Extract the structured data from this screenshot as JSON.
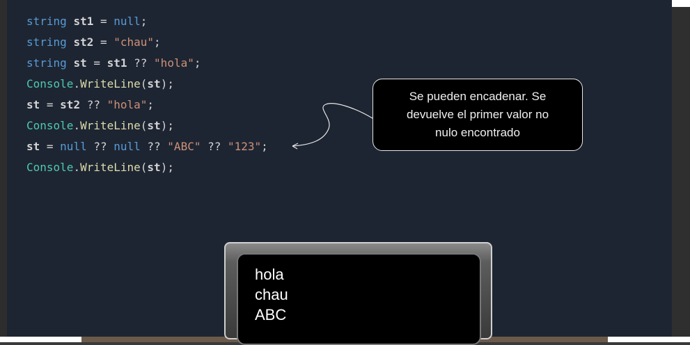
{
  "code": {
    "lines": [
      [
        {
          "t": "string ",
          "c": "kw"
        },
        {
          "t": "st1",
          "c": "var"
        },
        {
          "t": " = ",
          "c": "op"
        },
        {
          "t": "null",
          "c": "kw"
        },
        {
          "t": ";",
          "c": "op"
        }
      ],
      [
        {
          "t": "string ",
          "c": "kw"
        },
        {
          "t": "st2",
          "c": "var"
        },
        {
          "t": " = ",
          "c": "op"
        },
        {
          "t": "\"chau\"",
          "c": "str"
        },
        {
          "t": ";",
          "c": "op"
        }
      ],
      [
        {
          "t": "string ",
          "c": "kw"
        },
        {
          "t": "st",
          "c": "var"
        },
        {
          "t": " = ",
          "c": "op"
        },
        {
          "t": "st1",
          "c": "var"
        },
        {
          "t": " ?? ",
          "c": "op"
        },
        {
          "t": "\"hola\"",
          "c": "str"
        },
        {
          "t": ";",
          "c": "op"
        }
      ],
      [
        {
          "t": "Console",
          "c": "cls"
        },
        {
          "t": ".",
          "c": "op"
        },
        {
          "t": "WriteLine",
          "c": "mth"
        },
        {
          "t": "(",
          "c": "op"
        },
        {
          "t": "st",
          "c": "var"
        },
        {
          "t": ");",
          "c": "op"
        }
      ],
      [
        {
          "t": "st",
          "c": "var"
        },
        {
          "t": " = ",
          "c": "op"
        },
        {
          "t": "st2",
          "c": "var"
        },
        {
          "t": " ?? ",
          "c": "op"
        },
        {
          "t": "\"hola\"",
          "c": "str"
        },
        {
          "t": ";",
          "c": "op"
        }
      ],
      [
        {
          "t": "Console",
          "c": "cls"
        },
        {
          "t": ".",
          "c": "op"
        },
        {
          "t": "WriteLine",
          "c": "mth"
        },
        {
          "t": "(",
          "c": "op"
        },
        {
          "t": "st",
          "c": "var"
        },
        {
          "t": ");",
          "c": "op"
        }
      ],
      [
        {
          "t": "st",
          "c": "var"
        },
        {
          "t": " = ",
          "c": "op"
        },
        {
          "t": "null",
          "c": "kw"
        },
        {
          "t": " ?? ",
          "c": "op"
        },
        {
          "t": "null",
          "c": "kw"
        },
        {
          "t": " ?? ",
          "c": "op"
        },
        {
          "t": "\"ABC\"",
          "c": "str"
        },
        {
          "t": " ?? ",
          "c": "op"
        },
        {
          "t": "\"123\"",
          "c": "str"
        },
        {
          "t": ";",
          "c": "op"
        }
      ],
      [
        {
          "t": "Console",
          "c": "cls"
        },
        {
          "t": ".",
          "c": "op"
        },
        {
          "t": "WriteLine",
          "c": "mth"
        },
        {
          "t": "(",
          "c": "op"
        },
        {
          "t": "st",
          "c": "var"
        },
        {
          "t": ");",
          "c": "op"
        }
      ]
    ]
  },
  "callout": {
    "lines": [
      "Se pueden encadenar. Se",
      "devuelve el primer valor no",
      "nulo encontrado"
    ]
  },
  "console_output": {
    "lines": [
      "hola",
      "chau",
      "ABC"
    ]
  },
  "colors": {
    "editor_bg": "#1e2532",
    "keyword": "#569cd6",
    "string": "#ce9178",
    "class": "#4ec9b0",
    "method": "#dcdcaa"
  }
}
